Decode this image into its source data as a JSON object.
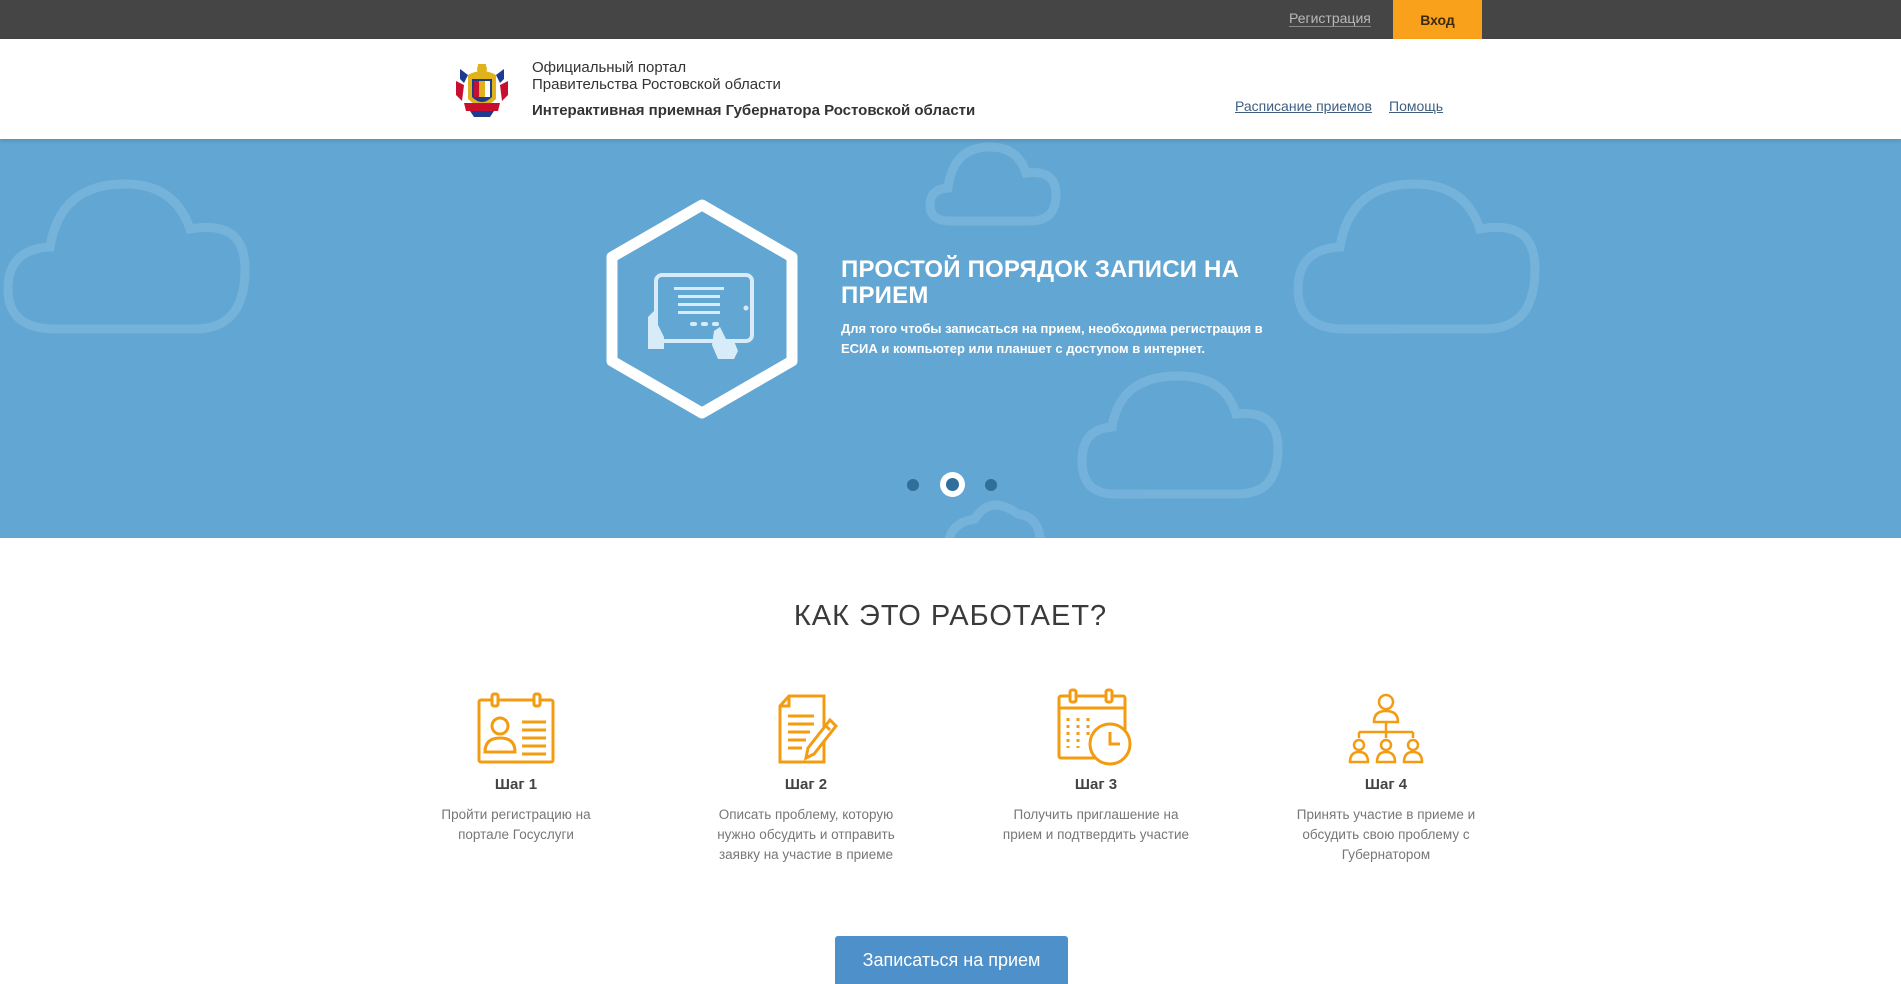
{
  "topbar": {
    "register_label": "Регистрация",
    "login_label": "Вход"
  },
  "header": {
    "portal_line1": "Официальный портал",
    "portal_line2": "Правительства Ростовской области",
    "title": "Интерактивная приемная Губернатора Ростовской области",
    "nav": {
      "schedule": "Расписание приемов",
      "help": "Помощь"
    }
  },
  "hero": {
    "title": "ПРОСТОЙ ПОРЯДОК ЗАПИСИ НА ПРИЕМ",
    "description": "Для того чтобы записаться на прием, необходима регистрация в ЕСИА и компьютер или планшет с доступом в интернет.",
    "slides_total": 3,
    "active_slide": 2,
    "icon": "tablet-touch-icon"
  },
  "how": {
    "title": "КАК ЭТО РАБОТАЕТ?",
    "steps": [
      {
        "title": "Шаг 1",
        "desc": "Пройти регистрацию на портале Госуслуги",
        "icon": "id-card-icon"
      },
      {
        "title": "Шаг 2",
        "desc": "Описать проблему, которую нужно обсудить и отправить заявку на участие в приеме",
        "icon": "document-pencil-icon"
      },
      {
        "title": "Шаг 3",
        "desc": "Получить приглашение на прием и подтвердить участие",
        "icon": "calendar-clock-icon"
      },
      {
        "title": "Шаг 4",
        "desc": "Принять участие в приеме и обсудить свою проблему с Губернатором",
        "icon": "org-chart-icon"
      }
    ]
  },
  "cta": {
    "label": "Записаться на прием"
  },
  "colors": {
    "topbar": "#454545",
    "accent": "#f9a11b",
    "hero_bg": "#62a6d3",
    "cta": "#4e90c9",
    "link": "#3f5f80"
  }
}
